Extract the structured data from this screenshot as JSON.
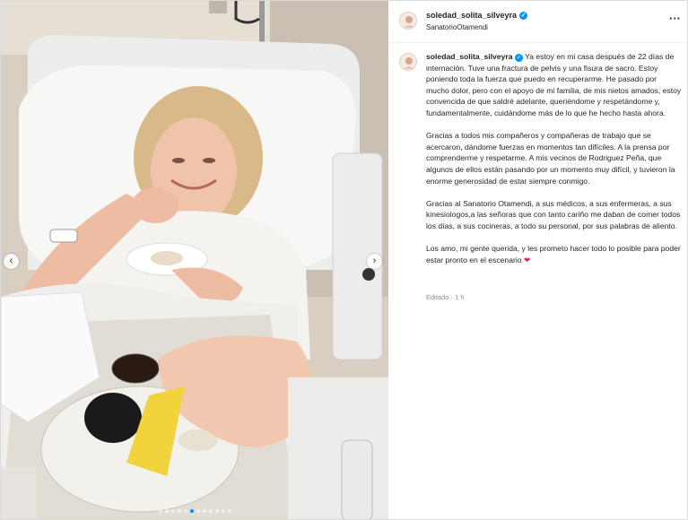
{
  "post": {
    "username": "soledad_solita_silveyra",
    "verified_symbol": "✓",
    "location": "SanatorioOtamendi",
    "more_icon_label": "···",
    "carousel": {
      "total_slides": 12,
      "active_index": 5,
      "prev_symbol": "‹",
      "next_symbol": "›"
    }
  },
  "caption": {
    "p1": "Ya estoy en mi casa después de 22 días de internación. Tuve una fractura de pelvis y una fisura de sacro. Estoy poniendo toda la fuerza que puedo en recuperarme. He pasado por mucho dolor, pero con el apoyo de mi familia, de mis nietos amados, estoy convencida de que saldré adelante, queriéndome y respetándome y, fundamentalmente, cuidándome más de lo que he hecho hasta ahora.",
    "p2": "Gracias a todos mis compañeros y compañeras de trabajo que se acercaron, dándome fuerzas en momentos tan difíciles. A la prensa por comprenderme y respetarme. A mis vecinos de Rodriguez Peña, que algunos de ellos están pasando por un momento muy difícil, y tuvieron la enorme generosidad de estar siempre conmigo.",
    "p3": "Gracias al Sanatorio Otamendi, a sus médicos, a sus enfermeras, a sus kinesiologos,a las señoras que con tanto cariño me daban de comer todos los días, a sus cocineras, a todo su personal, por sus palabras de aliento.",
    "p4": "Los amo, mi gente querida, y les prometo hacer todo lo posible para poder estar pronto en el escenario",
    "heart": "❤"
  },
  "meta": {
    "status": "Editado · 1 h"
  },
  "colors": {
    "accent": "#0095f6",
    "heart": "#e0245e",
    "muted": "#8e8e8e"
  }
}
